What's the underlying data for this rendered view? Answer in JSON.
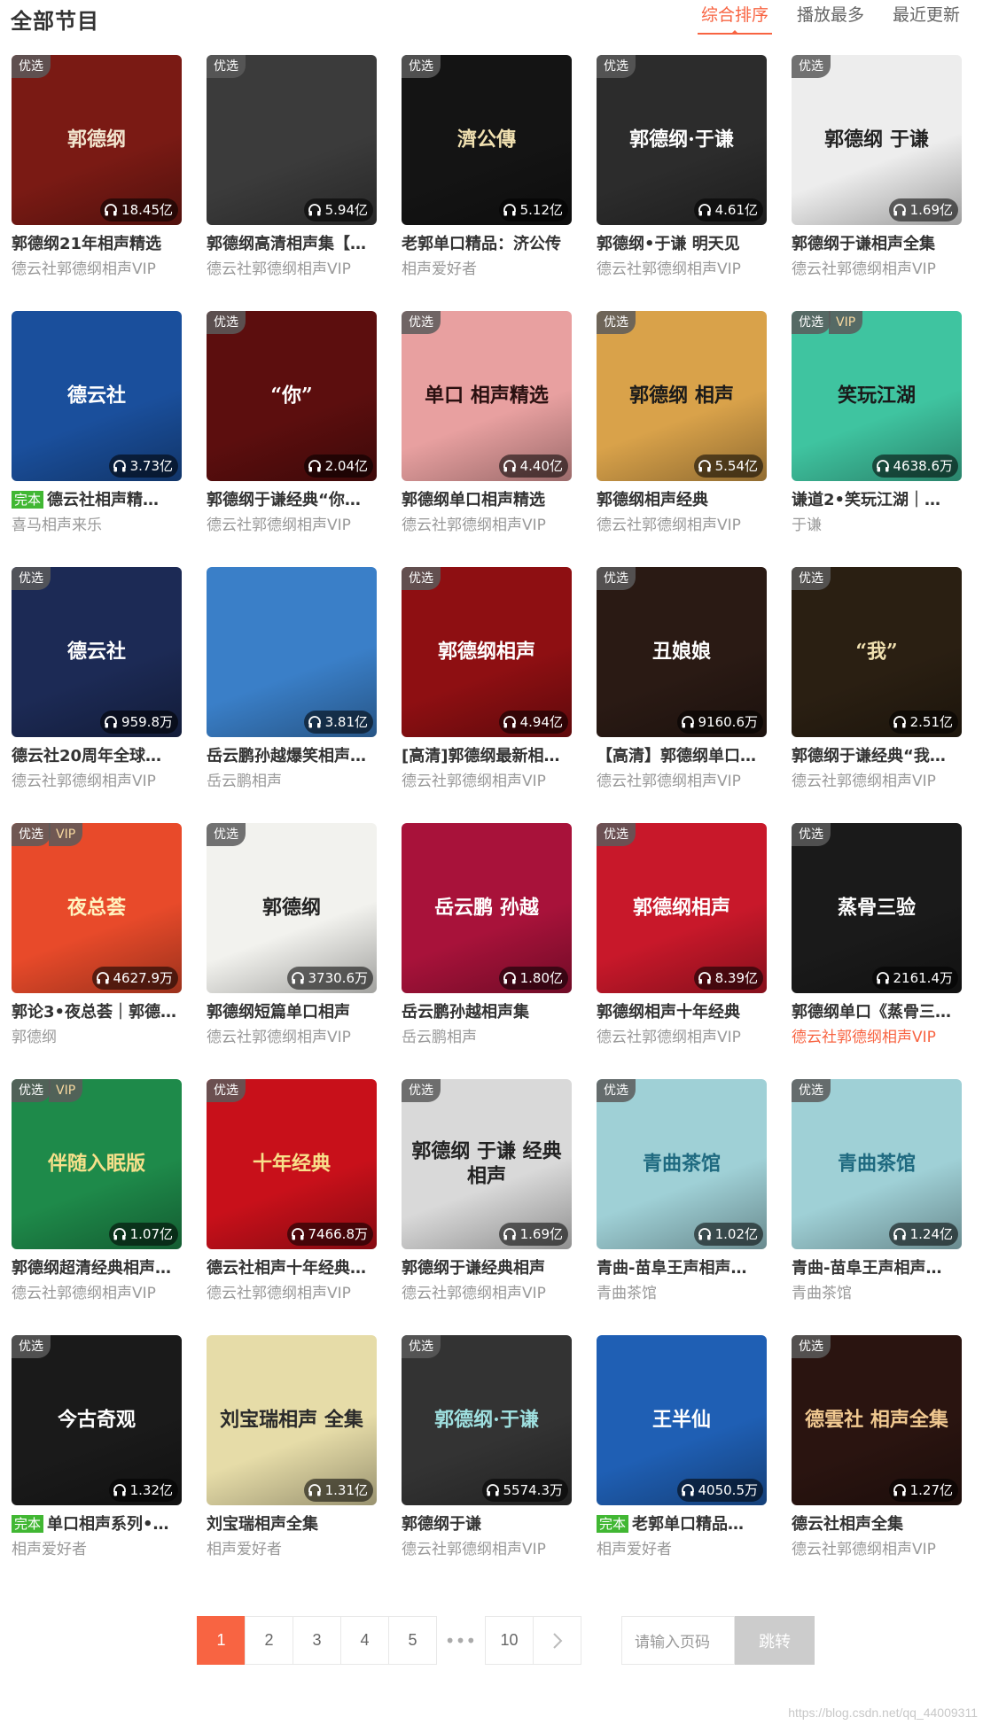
{
  "header": {
    "title": "全部节目",
    "tabs": [
      {
        "label": "综合排序",
        "active": true
      },
      {
        "label": "播放最多",
        "active": false
      },
      {
        "label": "最近更新",
        "active": false
      }
    ]
  },
  "colors": {
    "accent": "#f86442",
    "finished_badge": "#41b733"
  },
  "albums": [
    {
      "title": "郭德纲21年相声精选",
      "author": "德云社郭德纲相声VIP",
      "plays": "18.45亿",
      "tag": "优选",
      "vip": false,
      "finished": false,
      "cover_text": "郭德纲",
      "cover_bg": "#7a1a14",
      "cover_fg": "#f3e6cf"
    },
    {
      "title": "郭德纲高清相声集【…",
      "author": "德云社郭德纲相声VIP",
      "plays": "5.94亿",
      "tag": "优选",
      "vip": false,
      "finished": false,
      "cover_text": "",
      "cover_bg": "#3b3b3b",
      "cover_fg": "#ffffff"
    },
    {
      "title": "老郭单口精品：济公传",
      "author": "相声爱好者",
      "plays": "5.12亿",
      "tag": "优选",
      "vip": false,
      "finished": false,
      "cover_text": "濟公傳",
      "cover_bg": "#141414",
      "cover_fg": "#f0e0b0"
    },
    {
      "title": "郭德纲•于谦 明天见",
      "author": "德云社郭德纲相声VIP",
      "plays": "4.61亿",
      "tag": "优选",
      "vip": false,
      "finished": false,
      "cover_text": "郭德纲·于谦",
      "cover_bg": "#2c2c2c",
      "cover_fg": "#ffffff"
    },
    {
      "title": "郭德纲于谦相声全集",
      "author": "德云社郭德纲相声VIP",
      "plays": "1.69亿",
      "tag": "优选",
      "vip": false,
      "finished": false,
      "cover_text": "郭德纲 于谦",
      "cover_bg": "#ededed",
      "cover_fg": "#222222"
    },
    {
      "title": "德云社相声精…",
      "author": "喜马相声来乐",
      "plays": "3.73亿",
      "tag": "",
      "vip": false,
      "finished": true,
      "cover_text": "德云社",
      "cover_bg": "#1a4f9c",
      "cover_fg": "#ffffff"
    },
    {
      "title": "郭德纲于谦经典“你…",
      "author": "德云社郭德纲相声VIP",
      "plays": "2.04亿",
      "tag": "优选",
      "vip": false,
      "finished": false,
      "cover_text": "“你”",
      "cover_bg": "#5c0e0e",
      "cover_fg": "#ffffff"
    },
    {
      "title": "郭德纲单口相声精选",
      "author": "德云社郭德纲相声VIP",
      "plays": "4.40亿",
      "tag": "优选",
      "vip": false,
      "finished": false,
      "cover_text": "单口 相声精选",
      "cover_bg": "#e8a0a0",
      "cover_fg": "#2a1010"
    },
    {
      "title": "郭德纲相声经典",
      "author": "德云社郭德纲相声VIP",
      "plays": "5.54亿",
      "tag": "优选",
      "vip": false,
      "finished": false,
      "cover_text": "郭德纲 相声",
      "cover_bg": "#d9a24a",
      "cover_fg": "#1a1a1a"
    },
    {
      "title": "谦道2•笑玩江湖｜…",
      "author": "于谦",
      "plays": "4638.6万",
      "tag": "优选",
      "vip": true,
      "finished": false,
      "cover_text": "笑玩江湖",
      "cover_bg": "#3fc4a0",
      "cover_fg": "#1a1a1a"
    },
    {
      "title": "德云社20周年全球…",
      "author": "德云社郭德纲相声VIP",
      "plays": "959.8万",
      "tag": "优选",
      "vip": false,
      "finished": false,
      "cover_text": "德云社",
      "cover_bg": "#1c2a55",
      "cover_fg": "#ffffff"
    },
    {
      "title": "岳云鹏孙越爆笑相声…",
      "author": "岳云鹏相声",
      "plays": "3.81亿",
      "tag": "",
      "vip": false,
      "finished": false,
      "cover_text": "",
      "cover_bg": "#3a7fc8",
      "cover_fg": "#ffffff"
    },
    {
      "title": "[高清]郭德纲最新相…",
      "author": "德云社郭德纲相声VIP",
      "plays": "4.94亿",
      "tag": "优选",
      "vip": false,
      "finished": false,
      "cover_text": "郭德纲相声",
      "cover_bg": "#8e0f12",
      "cover_fg": "#ffffff"
    },
    {
      "title": "【高清】郭德纲单口…",
      "author": "德云社郭德纲相声VIP",
      "plays": "9160.6万",
      "tag": "优选",
      "vip": false,
      "finished": false,
      "cover_text": "丑娘娘",
      "cover_bg": "#2a1a14",
      "cover_fg": "#ffffff"
    },
    {
      "title": "郭德纲于谦经典“我…",
      "author": "德云社郭德纲相声VIP",
      "plays": "2.51亿",
      "tag": "优选",
      "vip": false,
      "finished": false,
      "cover_text": "“我”",
      "cover_bg": "#2a1f12",
      "cover_fg": "#f0e0b0"
    },
    {
      "title": "郭论3•夜总荟｜郭德…",
      "author": "郭德纲",
      "plays": "4627.9万",
      "tag": "优选",
      "vip": true,
      "finished": false,
      "cover_text": "夜总荟",
      "cover_bg": "#e84a2a",
      "cover_fg": "#fff4c0"
    },
    {
      "title": "郭德纲短篇单口相声",
      "author": "德云社郭德纲相声VIP",
      "plays": "3730.6万",
      "tag": "优选",
      "vip": false,
      "finished": false,
      "cover_text": "郭德纲",
      "cover_bg": "#f2f2ee",
      "cover_fg": "#222222"
    },
    {
      "title": "岳云鹏孙越相声集",
      "author": "岳云鹏相声",
      "plays": "1.80亿",
      "tag": "",
      "vip": false,
      "finished": false,
      "cover_text": "岳云鹏 孙越",
      "cover_bg": "#a8123a",
      "cover_fg": "#ffffff"
    },
    {
      "title": "郭德纲相声十年经典",
      "author": "德云社郭德纲相声VIP",
      "plays": "8.39亿",
      "tag": "优选",
      "vip": false,
      "finished": false,
      "cover_text": "郭德纲相声",
      "cover_bg": "#c8182a",
      "cover_fg": "#ffffff"
    },
    {
      "title": "郭德纲单口《蒸骨三…",
      "author": "德云社郭德纲相声VIP",
      "plays": "2161.4万",
      "tag": "优选",
      "vip": false,
      "finished": false,
      "cover_text": "蒸骨三验",
      "cover_bg": "#1a1a1a",
      "cover_fg": "#ffffff",
      "author_highlight": true
    },
    {
      "title": "郭德纲超清经典相声…",
      "author": "德云社郭德纲相声VIP",
      "plays": "1.07亿",
      "tag": "优选",
      "vip": true,
      "finished": false,
      "cover_text": "伴随入眠版",
      "cover_bg": "#1e8a4a",
      "cover_fg": "#f6e08a"
    },
    {
      "title": "德云社相声十年经典…",
      "author": "德云社郭德纲相声VIP",
      "plays": "7466.8万",
      "tag": "优选",
      "vip": false,
      "finished": false,
      "cover_text": "十年经典",
      "cover_bg": "#c8101a",
      "cover_fg": "#f8e08a"
    },
    {
      "title": "郭德纲于谦经典相声",
      "author": "德云社郭德纲相声VIP",
      "plays": "1.69亿",
      "tag": "优选",
      "vip": false,
      "finished": false,
      "cover_text": "郭德纲 于谦 经典相声",
      "cover_bg": "#d9d9d9",
      "cover_fg": "#222222"
    },
    {
      "title": "青曲-苗阜王声相声…",
      "author": "青曲茶馆",
      "plays": "1.02亿",
      "tag": "优选",
      "vip": false,
      "finished": false,
      "cover_text": "青曲茶馆",
      "cover_bg": "#9fd0d6",
      "cover_fg": "#1f6a80"
    },
    {
      "title": "青曲-苗阜王声相声…",
      "author": "青曲茶馆",
      "plays": "1.24亿",
      "tag": "优选",
      "vip": false,
      "finished": false,
      "cover_text": "青曲茶馆",
      "cover_bg": "#9fd0d6",
      "cover_fg": "#1f6a80"
    },
    {
      "title": "单口相声系列•…",
      "author": "相声爱好者",
      "plays": "1.32亿",
      "tag": "优选",
      "vip": false,
      "finished": true,
      "cover_text": "今古奇观",
      "cover_bg": "#1a1a1a",
      "cover_fg": "#ffffff"
    },
    {
      "title": "刘宝瑞相声全集",
      "author": "相声爱好者",
      "plays": "1.31亿",
      "tag": "",
      "vip": false,
      "finished": false,
      "cover_text": "刘宝瑞相声 全集",
      "cover_bg": "#e6dca8",
      "cover_fg": "#2a2a2a"
    },
    {
      "title": "郭德纲于谦",
      "author": "德云社郭德纲相声VIP",
      "plays": "5574.3万",
      "tag": "优选",
      "vip": false,
      "finished": false,
      "cover_text": "郭德纲·于谦",
      "cover_bg": "#333333",
      "cover_fg": "#9fe0e0"
    },
    {
      "title": "老郭单口精品…",
      "author": "相声爱好者",
      "plays": "4050.5万",
      "tag": "",
      "vip": false,
      "finished": true,
      "cover_text": "王半仙",
      "cover_bg": "#1f5fb4",
      "cover_fg": "#ffffff"
    },
    {
      "title": "德云社相声全集",
      "author": "德云社郭德纲相声VIP",
      "plays": "1.27亿",
      "tag": "优选",
      "vip": false,
      "finished": false,
      "cover_text": "德雲社 相声全集",
      "cover_bg": "#2a1410",
      "cover_fg": "#f0c890"
    }
  ],
  "labels": {
    "finished": "完本",
    "vip": "VIP"
  },
  "pagination": {
    "pages": [
      "1",
      "2",
      "3",
      "4",
      "5"
    ],
    "current": "1",
    "ellipsis": "•••",
    "last": "10",
    "input_placeholder": "请输入页码",
    "jump_label": "跳转"
  },
  "watermark": "https://blog.csdn.net/qq_44009311"
}
